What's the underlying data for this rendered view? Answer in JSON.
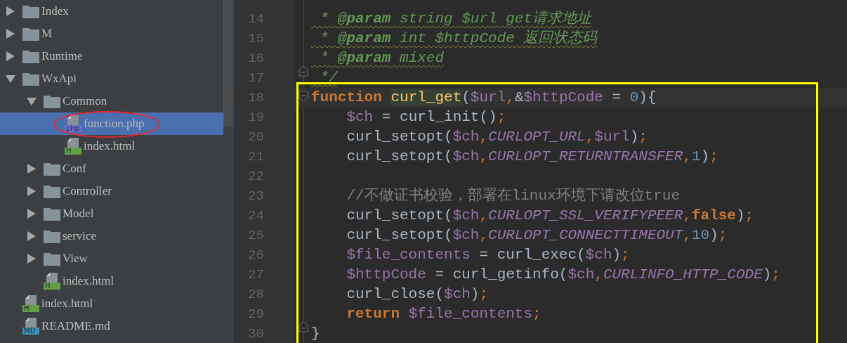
{
  "project_tree": [
    {
      "name": "Index",
      "kind": "folder",
      "expanded": false,
      "selected": false
    },
    {
      "name": "M",
      "kind": "folder",
      "expanded": false,
      "selected": false
    },
    {
      "name": "Runtime",
      "kind": "folder",
      "expanded": false,
      "selected": false
    },
    {
      "name": "WxApi",
      "kind": "folder",
      "expanded": true,
      "selected": false,
      "children": [
        {
          "name": "Common",
          "kind": "folder",
          "expanded": true,
          "selected": false,
          "children": [
            {
              "name": "function.php",
              "kind": "file",
              "badge": "php",
              "color": "#6f6fd0",
              "selected": true,
              "circled": true
            },
            {
              "name": "index.html",
              "kind": "file",
              "badge": "H",
              "color": "#62a048",
              "selected": false,
              "circled": false
            }
          ]
        },
        {
          "name": "Conf",
          "kind": "folder",
          "expanded": false,
          "selected": false
        },
        {
          "name": "Controller",
          "kind": "folder",
          "expanded": false,
          "selected": false
        },
        {
          "name": "Model",
          "kind": "folder",
          "expanded": false,
          "selected": false
        },
        {
          "name": "service",
          "kind": "folder",
          "expanded": false,
          "selected": false
        },
        {
          "name": "View",
          "kind": "folder",
          "expanded": false,
          "selected": false
        },
        {
          "name": "index.html",
          "kind": "file",
          "badge": "H",
          "color": "#62a048",
          "selected": false,
          "circled": false
        }
      ]
    },
    {
      "name": "index.html",
      "kind": "file",
      "badge": "H",
      "color": "#62a048",
      "selected": false,
      "circled": false
    },
    {
      "name": "README.md",
      "kind": "file",
      "badge": "MD",
      "color": "#3c8fb8",
      "selected": false,
      "circled": false
    }
  ],
  "editor": {
    "lines": [
      {
        "number": "14",
        "current": false,
        "fold_start": false,
        "fold_end": false,
        "tokens": [
          {
            "kind": "doc",
            "text": " * "
          },
          {
            "kind": "doc_tag",
            "text": "@param"
          },
          {
            "kind": "doc",
            "text": " string $url get请求地址"
          }
        ]
      },
      {
        "number": "15",
        "current": false,
        "fold_start": false,
        "fold_end": false,
        "tokens": [
          {
            "kind": "doc",
            "text": " * "
          },
          {
            "kind": "doc_tag",
            "text": "@param"
          },
          {
            "kind": "doc",
            "text": " int $httpCode 返回状态码"
          }
        ]
      },
      {
        "number": "16",
        "current": false,
        "fold_start": false,
        "fold_end": false,
        "tokens": [
          {
            "kind": "doc",
            "text": " * "
          },
          {
            "kind": "doc_tag",
            "text": "@param"
          },
          {
            "kind": "doc",
            "text": " mixed"
          }
        ]
      },
      {
        "number": "17",
        "current": false,
        "fold_start": false,
        "fold_end": true,
        "tokens": [
          {
            "kind": "doc",
            "text": " */"
          }
        ]
      },
      {
        "number": "18",
        "current": true,
        "fold_start": true,
        "fold_end": false,
        "tokens": [
          {
            "kind": "keyword",
            "text": "function "
          },
          {
            "kind": "function_name",
            "text": "curl_get"
          },
          {
            "kind": "plain",
            "text": "("
          },
          {
            "kind": "variable",
            "text": "$url"
          },
          {
            "kind": "punct",
            "text": ","
          },
          {
            "kind": "plain",
            "text": "&"
          },
          {
            "kind": "variable",
            "text": "$httpCode"
          },
          {
            "kind": "plain",
            "text": " = "
          },
          {
            "kind": "number",
            "text": "0"
          },
          {
            "kind": "plain",
            "text": "){"
          }
        ]
      },
      {
        "number": "19",
        "current": false,
        "fold_start": false,
        "fold_end": false,
        "tokens": [
          {
            "kind": "variable",
            "text": "    $ch"
          },
          {
            "kind": "plain",
            "text": " = curl_init()"
          },
          {
            "kind": "punct",
            "text": ";"
          }
        ]
      },
      {
        "number": "20",
        "current": false,
        "fold_start": false,
        "fold_end": false,
        "tokens": [
          {
            "kind": "plain",
            "text": "    curl_setopt("
          },
          {
            "kind": "variable",
            "text": "$ch"
          },
          {
            "kind": "punct",
            "text": ","
          },
          {
            "kind": "constant",
            "text": "CURLOPT_URL"
          },
          {
            "kind": "punct",
            "text": ","
          },
          {
            "kind": "variable",
            "text": "$url"
          },
          {
            "kind": "plain",
            "text": ")"
          },
          {
            "kind": "punct",
            "text": ";"
          }
        ]
      },
      {
        "number": "21",
        "current": false,
        "fold_start": false,
        "fold_end": false,
        "tokens": [
          {
            "kind": "plain",
            "text": "    curl_setopt("
          },
          {
            "kind": "variable",
            "text": "$ch"
          },
          {
            "kind": "punct",
            "text": ","
          },
          {
            "kind": "constant",
            "text": "CURLOPT_RETURNTRANSFER"
          },
          {
            "kind": "punct",
            "text": ","
          },
          {
            "kind": "number",
            "text": "1"
          },
          {
            "kind": "plain",
            "text": ")"
          },
          {
            "kind": "punct",
            "text": ";"
          }
        ]
      },
      {
        "number": "22",
        "current": false,
        "fold_start": false,
        "fold_end": false
      },
      {
        "number": "23",
        "current": false,
        "fold_start": false,
        "fold_end": false,
        "tokens": [
          {
            "kind": "comment",
            "text": "    //不做证书校验，部署在linux环境下请改位true"
          }
        ]
      },
      {
        "number": "24",
        "current": false,
        "fold_start": false,
        "fold_end": false,
        "tokens": [
          {
            "kind": "plain",
            "text": "    curl_setopt("
          },
          {
            "kind": "variable",
            "text": "$ch"
          },
          {
            "kind": "punct",
            "text": ","
          },
          {
            "kind": "constant",
            "text": "CURLOPT_SSL_VERIFYPEER"
          },
          {
            "kind": "punct",
            "text": ","
          },
          {
            "kind": "keyword",
            "text": "false"
          },
          {
            "kind": "plain",
            "text": ")"
          },
          {
            "kind": "punct",
            "text": ";"
          }
        ]
      },
      {
        "number": "25",
        "current": false,
        "fold_start": false,
        "fold_end": false,
        "tokens": [
          {
            "kind": "plain",
            "text": "    curl_setopt("
          },
          {
            "kind": "variable",
            "text": "$ch"
          },
          {
            "kind": "punct",
            "text": ","
          },
          {
            "kind": "constant",
            "text": "CURLOPT_CONNECTTIMEOUT"
          },
          {
            "kind": "punct",
            "text": ","
          },
          {
            "kind": "number",
            "text": "10"
          },
          {
            "kind": "plain",
            "text": ")"
          },
          {
            "kind": "punct",
            "text": ";"
          }
        ]
      },
      {
        "number": "26",
        "current": false,
        "fold_start": false,
        "fold_end": false,
        "tokens": [
          {
            "kind": "variable",
            "text": "    $file_contents"
          },
          {
            "kind": "plain",
            "text": " = curl_exec("
          },
          {
            "kind": "variable",
            "text": "$ch"
          },
          {
            "kind": "plain",
            "text": ")"
          },
          {
            "kind": "punct",
            "text": ";"
          }
        ]
      },
      {
        "number": "27",
        "current": false,
        "fold_start": false,
        "fold_end": false,
        "tokens": [
          {
            "kind": "variable",
            "text": "    $httpCode"
          },
          {
            "kind": "plain",
            "text": " = curl_getinfo("
          },
          {
            "kind": "variable",
            "text": "$ch"
          },
          {
            "kind": "punct",
            "text": ","
          },
          {
            "kind": "constant",
            "text": "CURLINFO_HTTP_CODE"
          },
          {
            "kind": "plain",
            "text": ")"
          },
          {
            "kind": "punct",
            "text": ";"
          }
        ]
      },
      {
        "number": "28",
        "current": false,
        "fold_start": false,
        "fold_end": false,
        "tokens": [
          {
            "kind": "plain",
            "text": "    curl_close("
          },
          {
            "kind": "variable",
            "text": "$ch"
          },
          {
            "kind": "plain",
            "text": ")"
          },
          {
            "kind": "punct",
            "text": ";"
          }
        ]
      },
      {
        "number": "29",
        "current": false,
        "fold_start": false,
        "fold_end": false,
        "tokens": [
          {
            "kind": "keyword",
            "text": "    return "
          },
          {
            "kind": "variable",
            "text": "$file_contents"
          },
          {
            "kind": "punct",
            "text": ";"
          }
        ]
      },
      {
        "number": "30",
        "current": false,
        "fold_start": false,
        "fold_end": true,
        "tokens": [
          {
            "kind": "plain",
            "text": "}"
          }
        ]
      }
    ],
    "highlight_frame": {
      "color": "#ffff00"
    }
  }
}
